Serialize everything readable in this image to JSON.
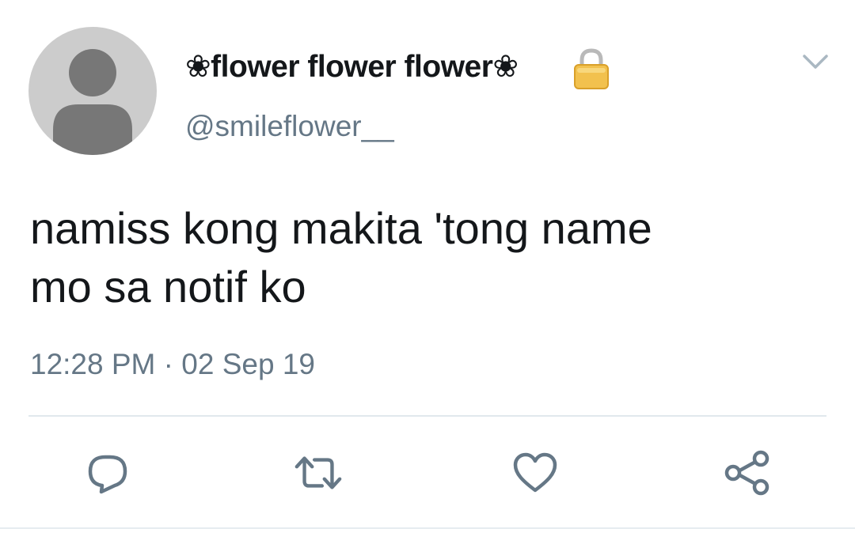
{
  "tweet": {
    "display_name": "❀flower flower flower❀",
    "handle": "@smileflower__",
    "text_line1": "namiss kong makita 'tong name",
    "text_line2": "mo sa notif ko",
    "time": "12:28 PM",
    "separator": " · ",
    "date": "02 Sep 19",
    "protected": true
  },
  "icons": {
    "avatar": "default-profile-icon",
    "lock": "lock-icon",
    "menu": "chevron-down-icon",
    "reply": "reply-icon",
    "retweet": "retweet-icon",
    "like": "heart-icon",
    "share": "share-icon"
  },
  "colors": {
    "text": "#14171a",
    "secondary": "#657786",
    "icon": "#657786",
    "avatar_bg": "#cccccc",
    "avatar_figure": "#777777",
    "divider": "#e1e8ed"
  }
}
